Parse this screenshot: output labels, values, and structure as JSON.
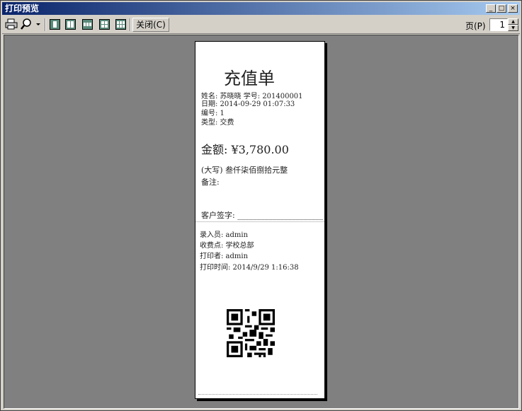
{
  "window": {
    "title": "打印预览"
  },
  "titlebar_buttons": {
    "minimize": "_",
    "maximize": "□",
    "close": "×"
  },
  "toolbar": {
    "close_label": "关闭(C)",
    "page_label": "页(P)",
    "page_value": "1"
  },
  "receipt": {
    "title": "充值单",
    "line_name": "姓名: 苏晓晓 学号: 201400001",
    "line_date": "日期: 2014-09-29 01:07:33",
    "line_number": "编号: 1",
    "line_type": "类型: 交费",
    "amount": "金额: ¥3,780.00",
    "amount_upper": "(大写) 叁仟柒佰捌拾元整",
    "remark": "备注:",
    "signature": "客户签字: ______________________",
    "entered_by": "录入员: admin",
    "collection_point": "收费点: 学校总部",
    "printer": "打印者: admin",
    "print_time": "打印时间: 2014/9/29 1:16:38"
  }
}
